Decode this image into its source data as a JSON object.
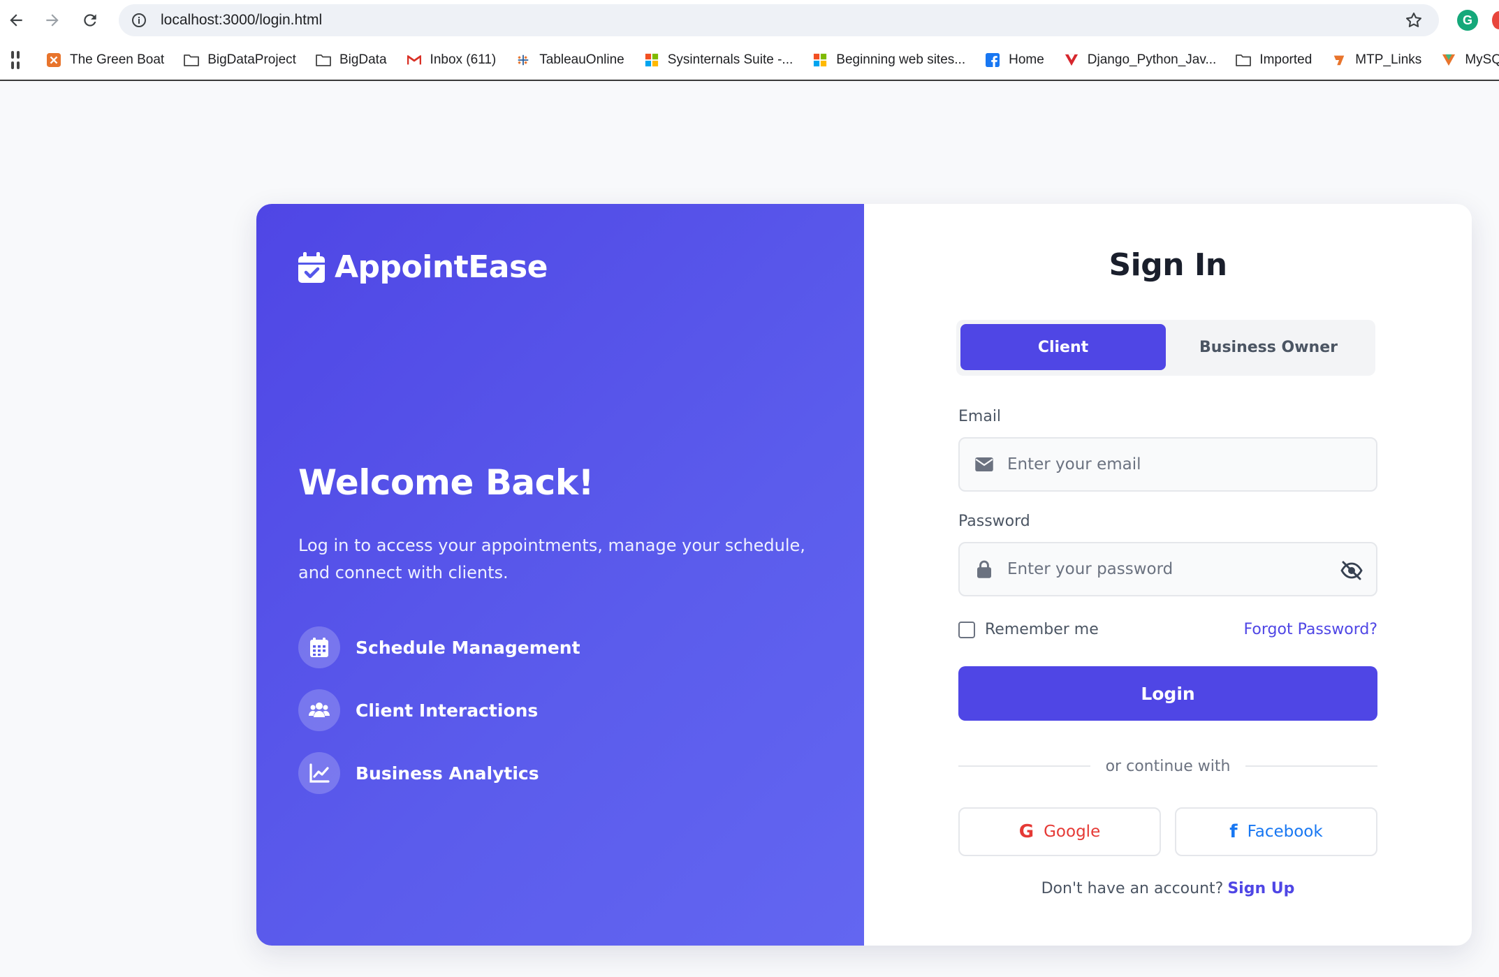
{
  "browser": {
    "url": "localhost:3000/login.html",
    "bookmarks": [
      {
        "label": "The Green Boat",
        "icon": "xampp-icon",
        "color": "#e8742c"
      },
      {
        "label": "BigDataProject",
        "icon": "folder-icon"
      },
      {
        "label": "BigData",
        "icon": "folder-icon"
      },
      {
        "label": "Inbox (611)",
        "icon": "gmail-icon"
      },
      {
        "label": "TableauOnline",
        "icon": "tableau-icon"
      },
      {
        "label": "Sysinternals Suite -...",
        "icon": "microsoft-icon"
      },
      {
        "label": "Beginning web sites...",
        "icon": "microsoft-icon"
      },
      {
        "label": "Home",
        "icon": "facebook-icon",
        "color": "#1877f2"
      },
      {
        "label": "Django_Python_Jav...",
        "icon": "vuejs-red-icon",
        "color": "#d6262d"
      },
      {
        "label": "Imported",
        "icon": "folder-icon"
      },
      {
        "label": "MTP_Links",
        "icon": "mtp-icon",
        "color": "#e8742c"
      },
      {
        "label": "MySQL INNER JOIN",
        "icon": "vuejs-multicolor-icon"
      }
    ]
  },
  "brand": {
    "name": "AppointEase",
    "icon": "calendar-check-icon"
  },
  "hero": {
    "title": "Welcome Back!",
    "text": "Log in to access your appointments, manage your schedule, and connect with clients.",
    "features": [
      {
        "label": "Schedule Management",
        "icon": "calendar-grid-icon"
      },
      {
        "label": "Client Interactions",
        "icon": "users-icon"
      },
      {
        "label": "Business Analytics",
        "icon": "chart-line-icon"
      }
    ]
  },
  "form": {
    "title": "Sign In",
    "roles": {
      "active": "Client",
      "inactive": "Business Owner"
    },
    "email": {
      "label": "Email",
      "placeholder": "Enter your email"
    },
    "password": {
      "label": "Password",
      "placeholder": "Enter your password"
    },
    "remember_label": "Remember me",
    "forgot_label": "Forgot Password?",
    "login_label": "Login",
    "divider_text": "or continue with",
    "social": {
      "google": "Google",
      "facebook": "Facebook"
    },
    "signup_prompt": "Don't have an account?",
    "signup_link": "Sign Up"
  },
  "colors": {
    "primary": "#4f46e5",
    "google": "#e53935",
    "facebook": "#1877f2"
  }
}
